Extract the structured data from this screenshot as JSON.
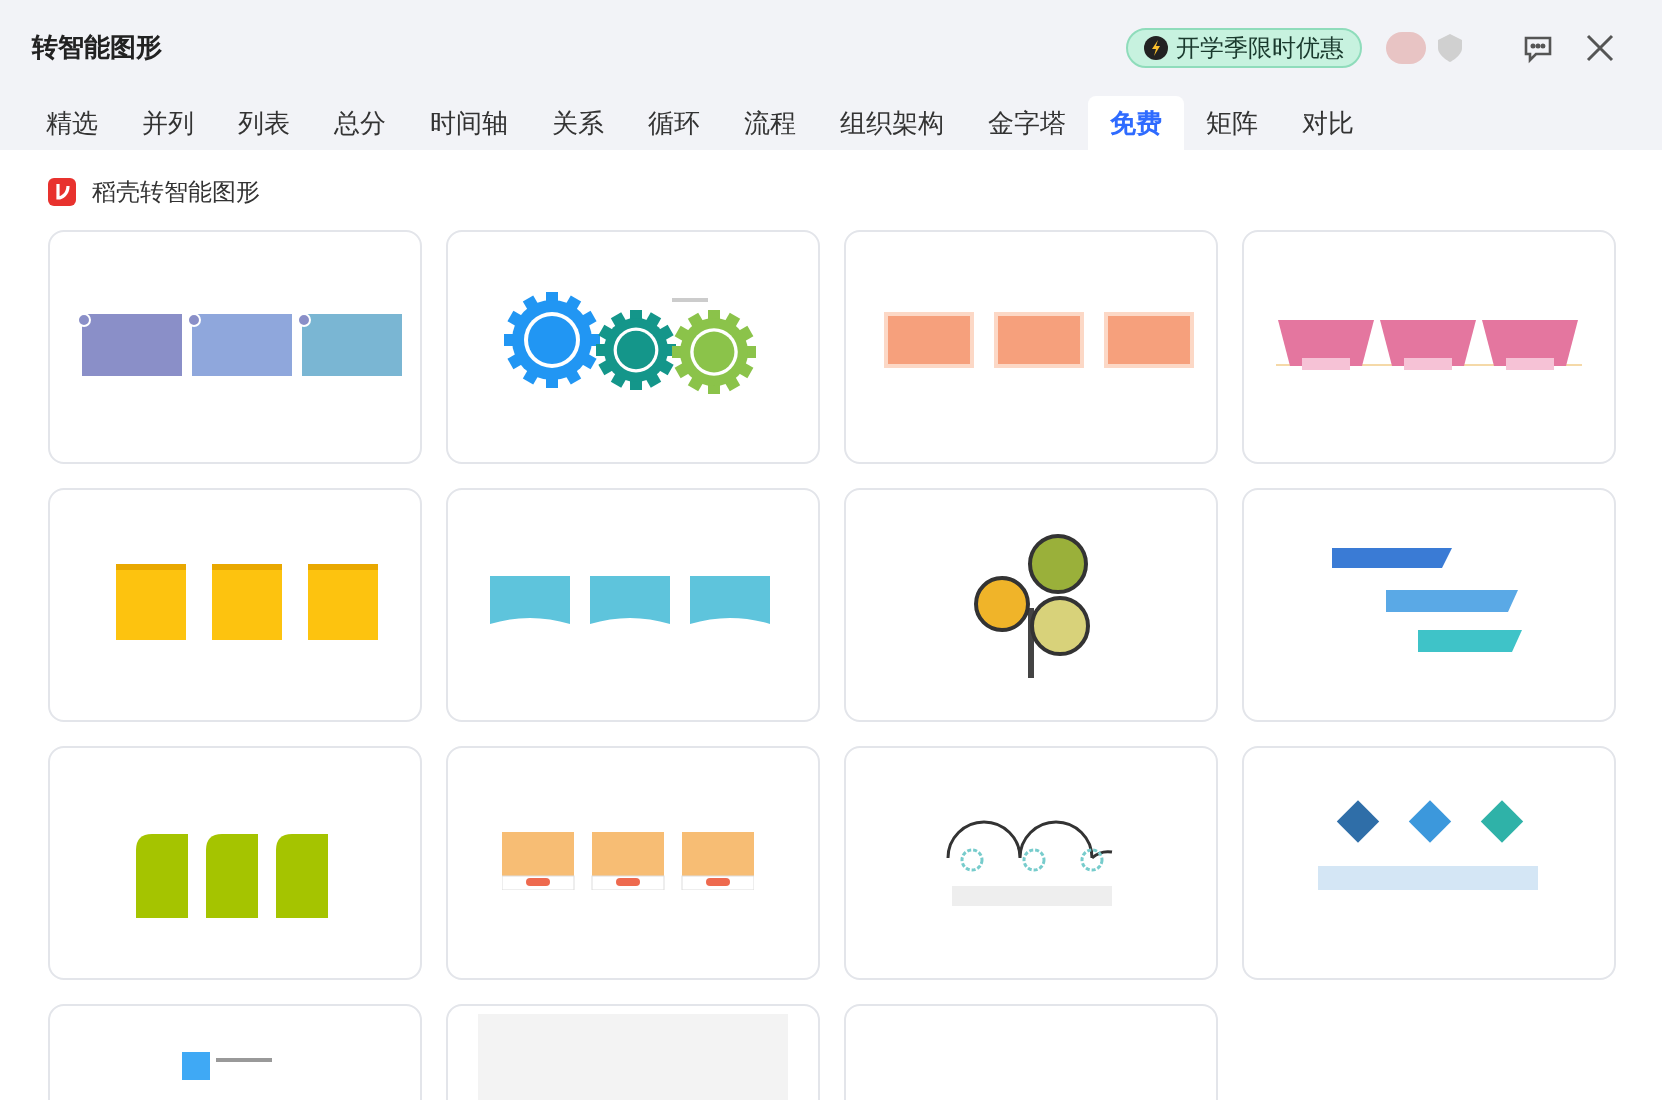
{
  "window": {
    "title": "转智能图形"
  },
  "promo": {
    "label": "开学季限时优惠"
  },
  "tabs": [
    {
      "label": "精选",
      "selected": false
    },
    {
      "label": "并列",
      "selected": false
    },
    {
      "label": "列表",
      "selected": false
    },
    {
      "label": "总分",
      "selected": false
    },
    {
      "label": "时间轴",
      "selected": false
    },
    {
      "label": "关系",
      "selected": false
    },
    {
      "label": "循环",
      "selected": false
    },
    {
      "label": "流程",
      "selected": false
    },
    {
      "label": "组织架构",
      "selected": false
    },
    {
      "label": "金字塔",
      "selected": false
    },
    {
      "label": "免费",
      "selected": true
    },
    {
      "label": "矩阵",
      "selected": false
    },
    {
      "label": "对比",
      "selected": false
    }
  ],
  "section": {
    "title": "稻壳转智能图形"
  },
  "templates": [
    {
      "kind": "notes"
    },
    {
      "kind": "gears"
    },
    {
      "kind": "numbered-boxes"
    },
    {
      "kind": "trapezoids"
    },
    {
      "kind": "folders"
    },
    {
      "kind": "banners"
    },
    {
      "kind": "balloons"
    },
    {
      "kind": "ribbons"
    },
    {
      "kind": "green-tabs"
    },
    {
      "kind": "orange-cards"
    },
    {
      "kind": "arcs"
    },
    {
      "kind": "diamonds"
    },
    {
      "kind": "list"
    },
    {
      "kind": "faint"
    },
    {
      "kind": "blank"
    }
  ]
}
